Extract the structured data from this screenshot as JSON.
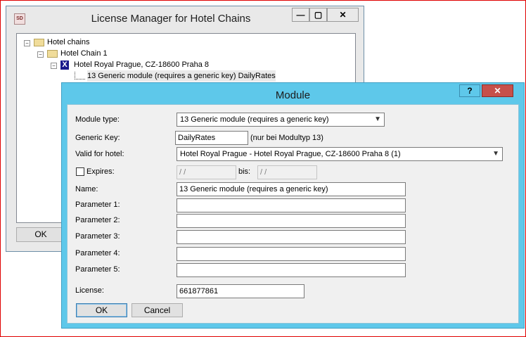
{
  "back_window": {
    "title": "License Manager for Hotel Chains",
    "app_icon": "SD",
    "minimize": "—",
    "maximize": "▢",
    "close": "✕",
    "tree": [
      {
        "label": "Hotel chains",
        "icon": "folder-icon"
      },
      {
        "label": "Hotel Chain 1",
        "icon": "folder-icon"
      },
      {
        "label": "Hotel Royal Prague, CZ-18600 Praha 8",
        "icon": "hotel-x-icon"
      },
      {
        "label": "13 Generic module (requires a generic key) DailyRates",
        "icon": "module-icon"
      }
    ],
    "ok_label": "OK"
  },
  "dialog": {
    "title": "Module",
    "help": "?",
    "close": "✕",
    "fields": {
      "module_type_label": "Module type:",
      "module_type_value": "13 Generic module (requires a generic key)",
      "generic_key_label": "Generic Key:",
      "generic_key_value": "DailyRates",
      "generic_key_hint": "(nur bei Modultyp 13)",
      "valid_for_hotel_label": "Valid for hotel:",
      "valid_for_hotel_value": "Hotel Royal Prague - Hotel Royal Prague, CZ-18600 Praha 8  (1)",
      "expires_label": "Expires:",
      "expires_from": " /  /",
      "bis_label": "bis:",
      "expires_to": " /  /",
      "name_label": "Name:",
      "name_value": "13 Generic module (requires a generic key)",
      "parameter1_label": "Parameter 1:",
      "parameter2_label": "Parameter 2:",
      "parameter3_label": "Parameter 3:",
      "parameter4_label": "Parameter 4:",
      "parameter5_label": "Parameter 5:",
      "license_label": "License:",
      "license_value": "661877861"
    },
    "ok_label": "OK",
    "cancel_label": "Cancel"
  },
  "colors": {
    "dialog_title": "#5ec8ea",
    "close_button": "#c7504a",
    "outer_border": "#e00000"
  }
}
